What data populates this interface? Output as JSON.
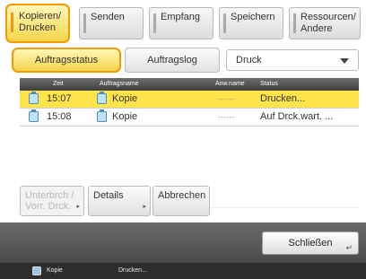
{
  "top_tabs": [
    {
      "line1": "Kopieren/",
      "line2": "Drucken"
    },
    {
      "line1": "Senden",
      "line2": ""
    },
    {
      "line1": "Empfang",
      "line2": ""
    },
    {
      "line1": "Speichern",
      "line2": ""
    },
    {
      "line1": "Ressourcen/",
      "line2": "Andere"
    }
  ],
  "sub_tabs": {
    "status": "Auftragsstatus",
    "log": "Auftragslog"
  },
  "filter": {
    "value": "Druck"
  },
  "table": {
    "headers": {
      "time": "Zeit",
      "name": "Auftragsname",
      "user": "Anw.name",
      "status": "Status"
    },
    "rows": [
      {
        "time": "15:07",
        "name": "Kopie",
        "user": "------",
        "status": "Drucken..."
      },
      {
        "time": "15:08",
        "name": "Kopie",
        "user": "------",
        "status": "Auf Drck.wart. ..."
      }
    ]
  },
  "buttons": {
    "interrupt_line1": "Unterbrch /",
    "interrupt_line2": "Vorr. Drck.",
    "details": "Details",
    "cancel": "Abbrechen",
    "close": "Schließen"
  },
  "status_bar": {
    "job": "Kopie",
    "state": "Drucken..."
  },
  "colors": {
    "accent_orange": "#f29a00",
    "selected_yellow": "#ffe34a"
  }
}
